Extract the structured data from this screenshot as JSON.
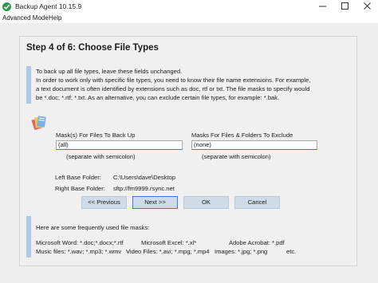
{
  "window": {
    "title": "Backup Agent 10.15.9"
  },
  "menu": {
    "items": [
      "Advanced Mode",
      "Help"
    ]
  },
  "wizard": {
    "step_title": "Step 4 of 6: Choose File Types",
    "info_lines": [
      "To back up all file types, leave these fields unchanged.",
      "In order to work only with specific file types, you need to know their file name extensions. For example,",
      "a text document is often identified by extensions such as doc, rtf or txt. The file masks to specify would",
      "be *.doc; *.rtf; *.txt. As an alternative, you can exclude certain file types, for example: *.bak."
    ],
    "include_label": "Mask(s) For Files To Back Up",
    "include_value": "(all)",
    "include_hint": "(separate with semicolon)",
    "exclude_label": "Masks For Files & Folders To Exclude",
    "exclude_value": "(none)",
    "exclude_hint": "(separate with semicolon)",
    "left_base_label": "Left Base Folder:",
    "left_base_value": "C:\\Users\\dave\\Desktop",
    "right_base_label": "Right Base Folder:",
    "right_base_value": "sftp://fm9999.rsync.net",
    "buttons": {
      "previous": "<< Previous",
      "next": "Next >>",
      "ok": "OK",
      "cancel": "Cancel"
    },
    "masks_title": "Here are some frequently used file masks:",
    "masks": {
      "word": "Microsoft Word: *.doc;*.docx;*.rtf",
      "excel": "Microsoft Excel: *.xl*",
      "acrobat": "Adobe Acrobat: *.pdf",
      "music": "Music files: *.wav; *.mp3; *.wmv",
      "video": "Video Files: *.avi; *.mpg; *.mp4",
      "images": "Images: *.jpg; *.png",
      "etc": "etc."
    }
  },
  "icons": {
    "app": "backup-agent-icon",
    "minimize": "minimize-icon",
    "maximize": "maximize-icon",
    "close": "close-icon",
    "folders": "file-types-icon"
  },
  "colors": {
    "accent_bar": "#aec8e6",
    "button_fill": "#cfdbe9",
    "focus_border": "#3c78d0"
  }
}
